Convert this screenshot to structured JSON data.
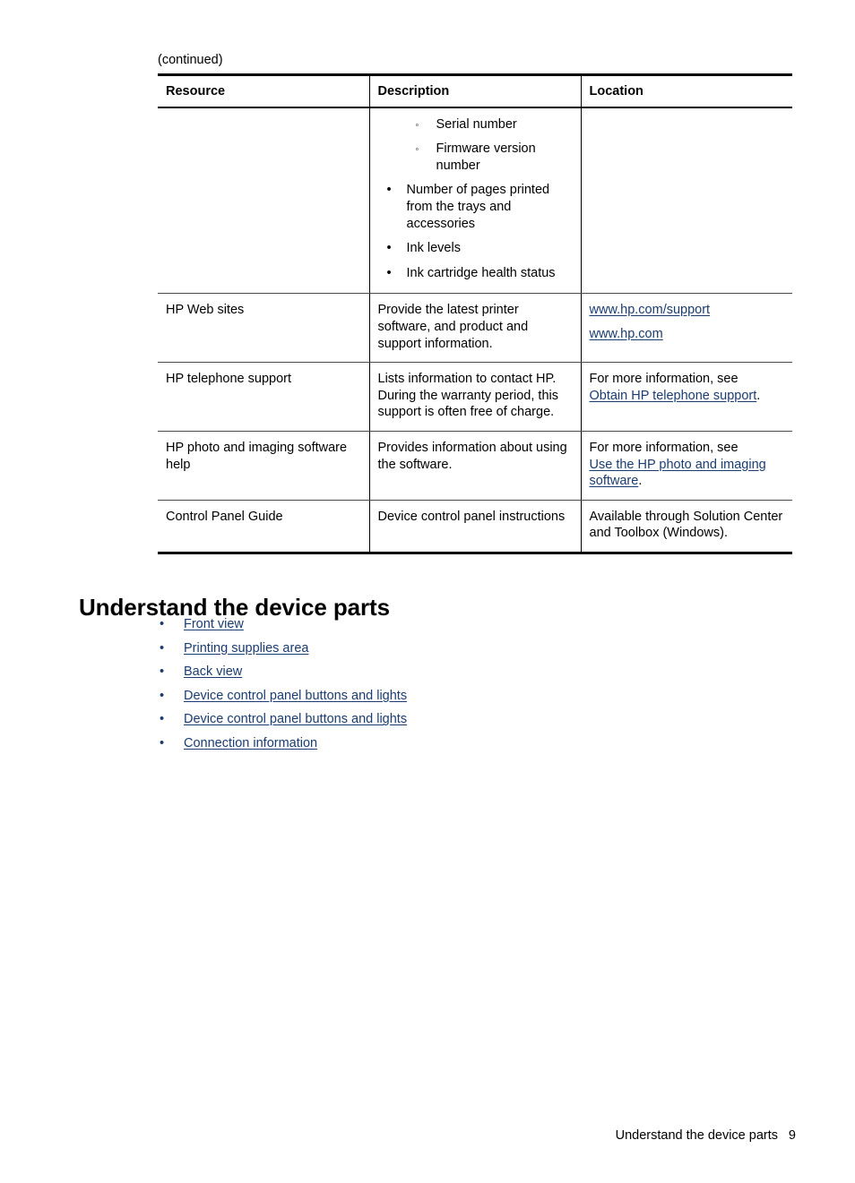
{
  "page": {
    "continued_label": "(continued)"
  },
  "table": {
    "headers": [
      "Resource",
      "Description",
      "Location"
    ],
    "rows": [
      {
        "resource": "",
        "description_list": [
          {
            "level": "sub",
            "bullet": "◦",
            "text": "Serial number"
          },
          {
            "level": "sub",
            "bullet": "◦",
            "text": "Firmware version number"
          },
          {
            "level": "main",
            "bullet": "•",
            "text": "Number of pages printed from the trays and accessories"
          },
          {
            "level": "main",
            "bullet": "•",
            "text": "Ink levels"
          },
          {
            "level": "main",
            "bullet": "•",
            "text": "Ink cartridge health status"
          }
        ],
        "location_lead": "",
        "location_links": [],
        "location_tail": ""
      },
      {
        "resource": "HP Web sites",
        "description": "Provide the latest printer software, and product and support information.",
        "location_lead": "",
        "location_links": [
          "www.hp.com/support",
          "www.hp.com"
        ],
        "location_tail": ""
      },
      {
        "resource": "HP telephone support",
        "description": "Lists information to contact HP. During the warranty period, this support is often free of charge.",
        "location_lead": "For more information, see ",
        "location_links": [
          "Obtain HP telephone support"
        ],
        "location_tail": "."
      },
      {
        "resource": "HP photo and imaging software help",
        "description": "Provides information about using the software.",
        "location_lead": "For more information, see ",
        "location_links": [
          "Use the HP photo and imaging software"
        ],
        "location_tail": "."
      },
      {
        "resource": "Control Panel Guide",
        "description": "Device control panel instructions",
        "location_lead": "Available through Solution Center and Toolbox (Windows).",
        "location_links": [],
        "location_tail": ""
      }
    ]
  },
  "section": {
    "heading": "Understand the device parts",
    "bullet": "•",
    "links": [
      "Front view",
      "Printing supplies area",
      "Back view",
      "Device control panel buttons and lights",
      "Device control panel buttons and lights",
      "Connection information"
    ]
  },
  "footer": {
    "title": "Understand the device parts",
    "page_number": "9"
  },
  "colors": {
    "link": "#1a3c70",
    "text": "#000000",
    "rule_thick": "#000000",
    "rule_thin": "#4a4a4a"
  }
}
